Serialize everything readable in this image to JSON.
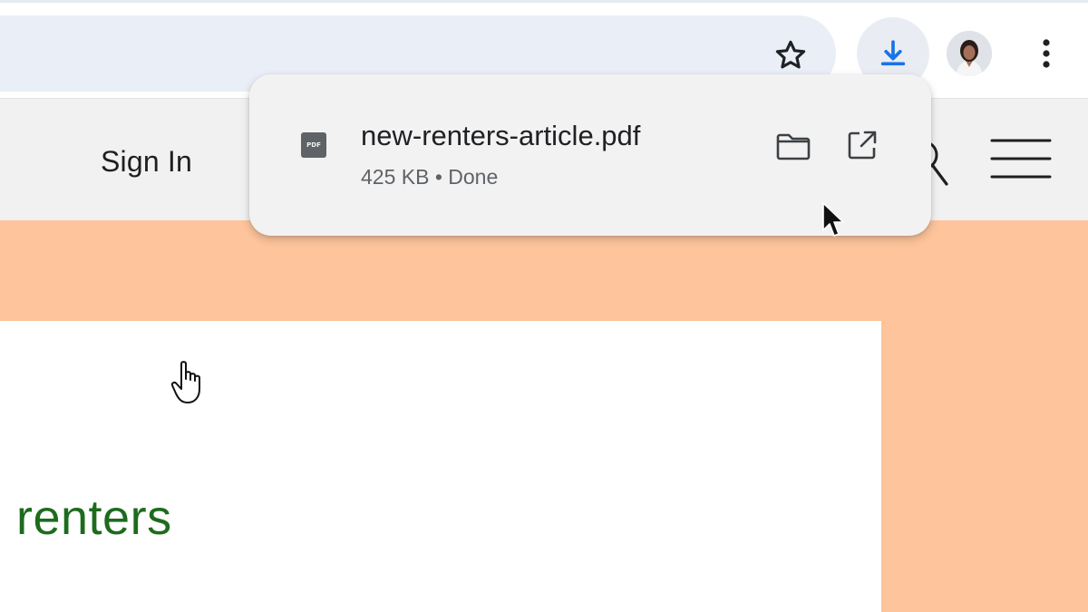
{
  "browser": {
    "toolbar_icons": {
      "bookmark": "star-icon",
      "downloads": "download-icon",
      "profile": "avatar",
      "menu": "more-vert-icon"
    },
    "accent_color": "#1a73e8"
  },
  "site_header": {
    "sign_in_label": "Sign In",
    "icons": [
      "search-icon",
      "hamburger-menu-icon"
    ]
  },
  "download_bubble": {
    "file_type_label": "PDF",
    "file_name": "new-renters-article.pdf",
    "status": "425 KB • Done",
    "actions": [
      "folder-icon",
      "open-external-icon"
    ]
  },
  "article": {
    "title": "renters",
    "title_color": "#1e6b1e",
    "hero_color": "#fec49b"
  }
}
